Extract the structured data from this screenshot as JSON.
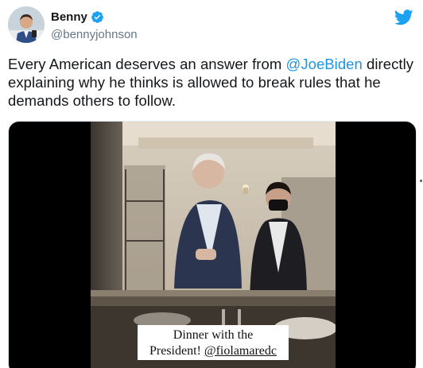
{
  "tweet": {
    "author": {
      "display_name": "Benny",
      "handle": "@bennyjohnson",
      "verified": true,
      "avatar_icon": "profile-photo"
    },
    "text": {
      "part1": "Every American deserves an answer from ",
      "mention": "@JoeBiden",
      "part2": " directly explaining why he thinks is allowed to break rules that he demands others to follow."
    },
    "media": {
      "type": "video",
      "caption_line1": "Dinner with the",
      "caption_line2_prefix": "President! ",
      "caption_tag": "@fiolamaredc"
    }
  },
  "icons": {
    "brand": "twitter-bird-icon",
    "verified": "verified-badge-icon"
  },
  "colors": {
    "brand": "#1da1f2",
    "link": "#1b95e0",
    "text": "#14171a",
    "secondary": "#657786"
  }
}
